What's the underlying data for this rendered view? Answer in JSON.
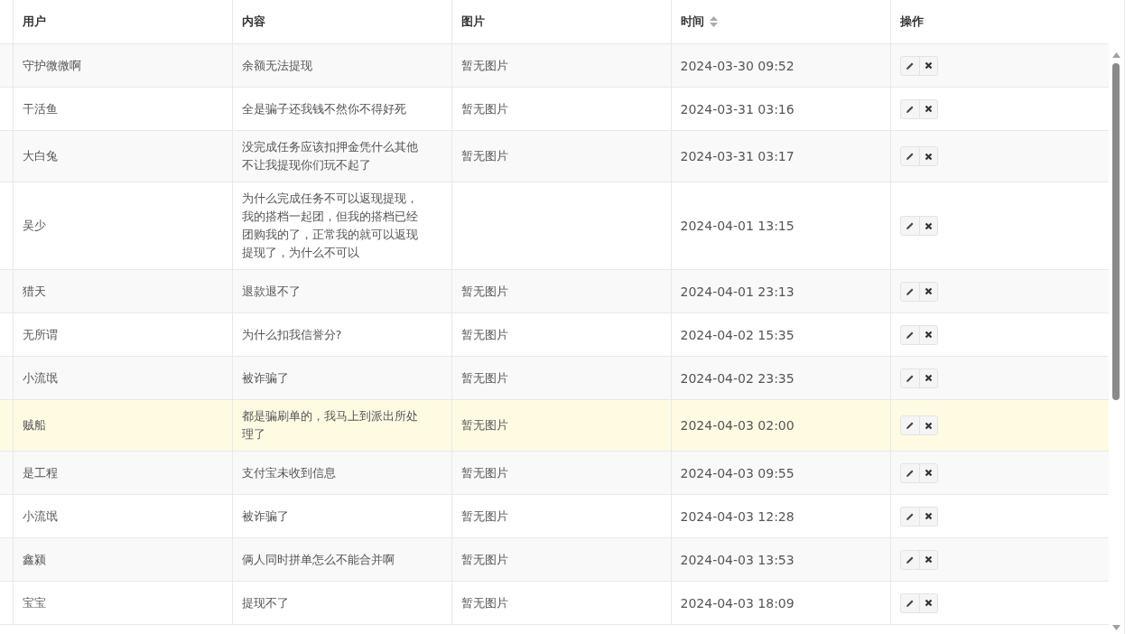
{
  "table": {
    "columns": [
      {
        "label": "用户",
        "sortable": false
      },
      {
        "label": "内容",
        "sortable": false
      },
      {
        "label": "图片",
        "sortable": false
      },
      {
        "label": "时间",
        "sortable": true
      },
      {
        "label": "操作",
        "sortable": false
      }
    ],
    "rows": [
      {
        "user": "守护微微啊",
        "content": "余额无法提现",
        "image": "暂无图片",
        "time": "2024-03-30 09:52",
        "highlighted": false
      },
      {
        "user": "干活鱼",
        "content": "全是骗子还我钱不然你不得好死",
        "image": "暂无图片",
        "time": "2024-03-31 03:16",
        "highlighted": false
      },
      {
        "user": "大白兔",
        "content": "没完成任务应该扣押金凭什么其他不让我提现你们玩不起了",
        "image": "暂无图片",
        "time": "2024-03-31 03:17",
        "highlighted": false
      },
      {
        "user": "吴少",
        "content": "为什么完成任务不可以返现提现，我的搭档一起团，但我的搭档已经团购我的了，正常我的就可以返现提现了，为什么不可以",
        "time": "2024-04-01 13:15",
        "highlighted": false
      },
      {
        "user": "猎天",
        "content": "退款退不了",
        "image": "暂无图片",
        "time": "2024-04-01 23:13",
        "highlighted": false
      },
      {
        "user": "无所谓",
        "content": "为什么扣我信誉分?",
        "image": "暂无图片",
        "time": "2024-04-02 15:35",
        "highlighted": false
      },
      {
        "user": "小流氓",
        "content": "被诈骗了",
        "image": "暂无图片",
        "time": "2024-04-02 23:35",
        "highlighted": false
      },
      {
        "user": "贼船",
        "content": "都是骗刷单的，我马上到派出所处理了",
        "image": "暂无图片",
        "time": "2024-04-03 02:00",
        "highlighted": true
      },
      {
        "user": "是工程",
        "content": "支付宝未收到信息",
        "image": "暂无图片",
        "time": "2024-04-03 09:55",
        "highlighted": false
      },
      {
        "user": "小流氓",
        "content": "被诈骗了",
        "image": "暂无图片",
        "time": "2024-04-03 12:28",
        "highlighted": false
      },
      {
        "user": "鑫颍",
        "content": "俩人同时拼单怎么不能合并啊",
        "image": "暂无图片",
        "time": "2024-04-03 13:53",
        "highlighted": false
      },
      {
        "user": "宝宝",
        "content": "提现不了",
        "image": "暂无图片",
        "time": "2024-04-03 18:09",
        "highlighted": false
      }
    ]
  }
}
